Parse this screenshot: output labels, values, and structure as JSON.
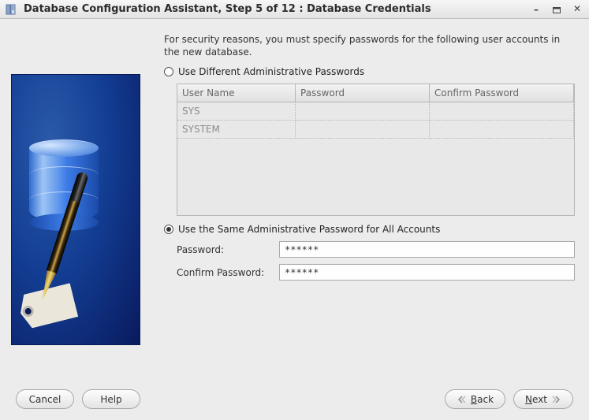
{
  "window": {
    "title": "Database Configuration Assistant, Step 5 of 12 : Database Credentials"
  },
  "intro": "For security reasons, you must specify passwords for the following user accounts in the new database.",
  "options": {
    "different": {
      "label": "Use Different Administrative Passwords",
      "selected": false,
      "columns": {
        "user": "User Name",
        "password": "Password",
        "confirm": "Confirm Password"
      },
      "rows": [
        {
          "user": "SYS",
          "password": "",
          "confirm": ""
        },
        {
          "user": "SYSTEM",
          "password": "",
          "confirm": ""
        }
      ]
    },
    "same": {
      "label": "Use the Same Administrative Password for All Accounts",
      "selected": true,
      "password_label": "Password:",
      "confirm_label": "Confirm Password:",
      "password_value": "******",
      "confirm_value": "******"
    }
  },
  "buttons": {
    "cancel": "Cancel",
    "help": "Help",
    "back": "Back",
    "back_mn": "B",
    "next": "Next",
    "next_mn": "N"
  }
}
